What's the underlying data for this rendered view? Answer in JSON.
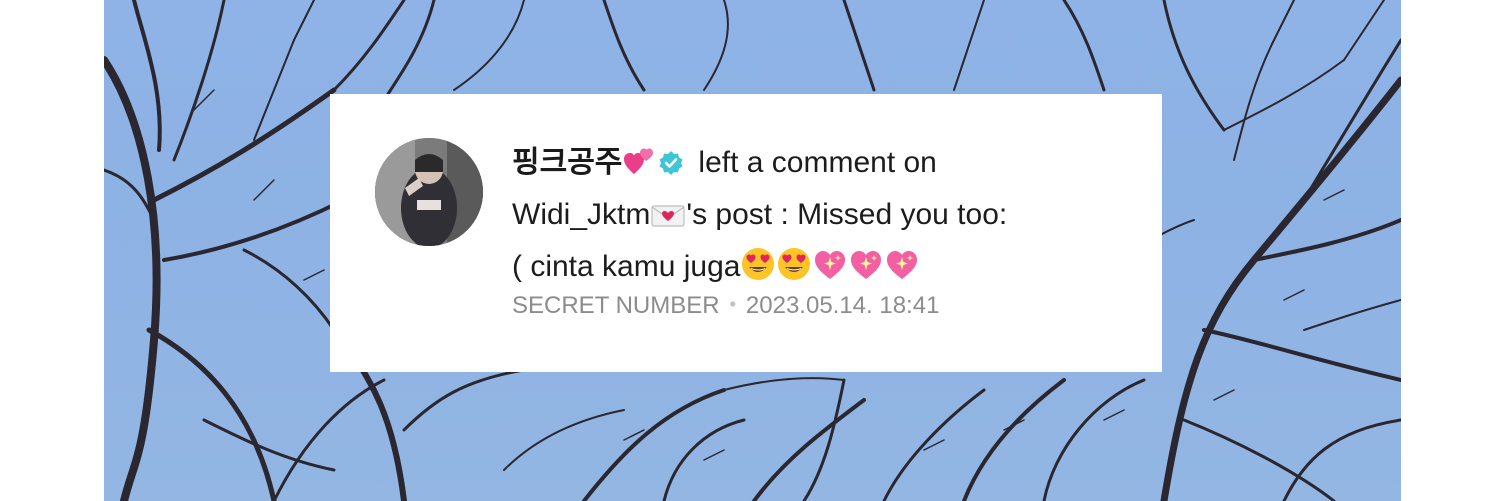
{
  "notification": {
    "username": "핑크공주",
    "username_emoji": "two-hearts",
    "verified_icon": "verified-badge-icon",
    "action_text": "left a comment on",
    "post_owner": "Widi_Jktm",
    "post_owner_emoji": "love-letter",
    "post_suffix": "'s post : Missed you too:",
    "comment_prefix": "(  cinta kamu juga",
    "comment_emojis": [
      "heart-eyes",
      "heart-eyes",
      "sparkling-heart",
      "sparkling-heart",
      "sparkling-heart"
    ],
    "group": "SECRET NUMBER",
    "timestamp": "2023.05.14. 18:41"
  },
  "colors": {
    "sky": "#8fb3e6",
    "branches": "#2b2730",
    "verified_badge": "#3cc6d8",
    "meta_text": "#8c8c8c"
  }
}
